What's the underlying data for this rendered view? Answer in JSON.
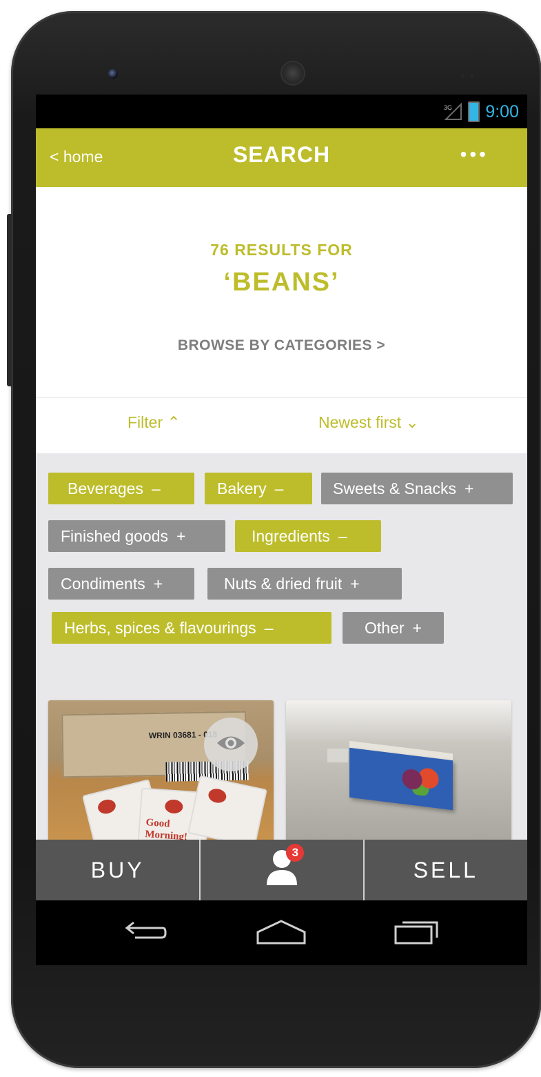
{
  "status_bar": {
    "network": "3G",
    "time": "9:00"
  },
  "app_bar": {
    "back_label": "< home",
    "title": "SEARCH",
    "more": "•••"
  },
  "search_summary": {
    "results": "76 RESULTS FOR",
    "query": "‘BEANS’",
    "browse": "BROWSE BY CATEGORIES >"
  },
  "filter_bar": {
    "filter_label": "Filter ⌃",
    "sort_label": "Newest first ⌄"
  },
  "categories": [
    {
      "label": "Beverages",
      "sign": "–",
      "active": true
    },
    {
      "label": "Bakery",
      "sign": "–",
      "active": true
    },
    {
      "label": "Sweets & Snacks",
      "sign": "+",
      "active": false
    },
    {
      "label": "Finished goods",
      "sign": "+",
      "active": false
    },
    {
      "label": "Ingredients",
      "sign": "–",
      "active": true
    },
    {
      "label": "Condiments",
      "sign": "+",
      "active": false
    },
    {
      "label": "Nuts & dried fruit",
      "sign": "+",
      "active": false
    },
    {
      "label": "Herbs, spices & flavourings",
      "sign": "–",
      "active": true
    },
    {
      "label": "Other",
      "sign": "+",
      "active": false
    }
  ],
  "products": [
    {
      "image": "cardboard box with Good Morning oat sachets",
      "box_label": "WRIN 03681 - 018",
      "packet_text": "Good Morning!",
      "icon": "eye-icon"
    },
    {
      "image": "blue fruit snack box on a steel counter"
    }
  ],
  "bottom_nav": {
    "buy": "BUY",
    "sell": "SELL",
    "notifications": "3"
  },
  "colors": {
    "accent": "#bdbd2b",
    "chip_off": "#909090",
    "nav": "#555555",
    "status_blue": "#33b5e5",
    "badge": "#e53935"
  }
}
